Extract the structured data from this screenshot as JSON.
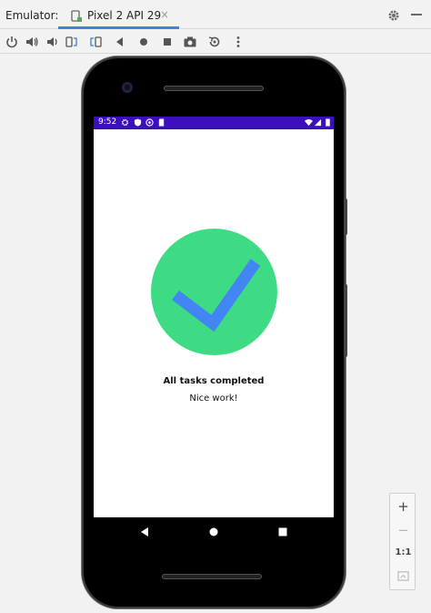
{
  "header": {
    "title": "Emulator:",
    "tab_label": "Pixel 2 API 29",
    "tab_close": "×"
  },
  "toolbar": {
    "buttons": [
      "power-icon",
      "volume-up-icon",
      "volume-down-icon",
      "rotate-left-icon",
      "rotate-right-icon",
      "back-icon",
      "home-icon",
      "overview-icon",
      "camera-icon",
      "snapshot-icon",
      "more-icon"
    ]
  },
  "device": {
    "status_time": "9:52",
    "status_bar_color": "#3b0fc0",
    "message_title": "All tasks completed",
    "message_subtitle": "Nice work!",
    "check_circle_color": "#3ddc84",
    "check_mark_color": "#4285f4"
  },
  "zoom": {
    "zoom_in": "+",
    "zoom_out": "−",
    "actual_size": "1:1"
  }
}
